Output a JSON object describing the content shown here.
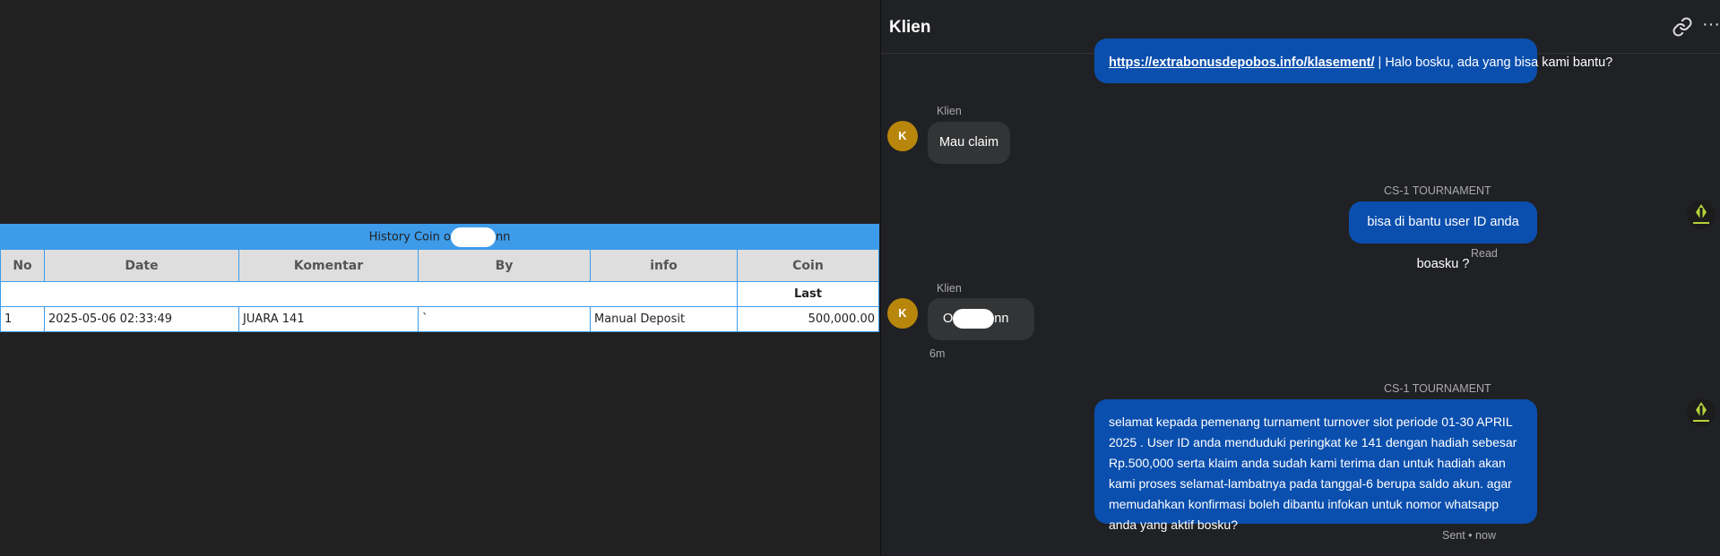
{
  "history": {
    "title_prefix": "History Coin o",
    "title_suffix": "nn",
    "columns": [
      "No",
      "Date",
      "Komentar",
      "By",
      "info",
      "Coin"
    ],
    "last_label": "Last",
    "rows": [
      {
        "no": "1",
        "date": "2025-05-06 02:33:49",
        "komentar": "JUARA 141",
        "by": "`",
        "info": "Manual Deposit",
        "coin": "500,000.00"
      }
    ]
  },
  "chat": {
    "title": "Klien",
    "more_label": "···",
    "msg1": {
      "link": "https://extrabonusdepobos.info/klasement/",
      "sep": "|",
      "text": "Halo bosku, ada yang bisa kami bantu?"
    },
    "msg2": {
      "sender": "Klien",
      "avatar": "K",
      "text": "Mau claim"
    },
    "msg3": {
      "sender": "CS-1 TOURNAMENT",
      "text": "bisa di bantu user ID anda boasku ?",
      "status": "Read"
    },
    "msg4": {
      "sender": "Klien",
      "avatar": "K",
      "text_prefix": "O",
      "text_suffix": "nn",
      "time": "6m"
    },
    "msg5": {
      "sender": "CS-1 TOURNAMENT",
      "text": "selamat kepada pemenang turnament turnover slot periode 01-30 APRIL 2025 . User ID anda menduduki peringkat ke 141 dengan hadiah sebesar Rp.500,000 serta klaim anda sudah kami terima dan untuk hadiah akan kami proses selamat-lambatnya pada tanggal-6 berupa saldo akun. agar memudahkan konfirmasi boleh dibantu infokan untuk nomor whatsapp anda yang aktif bosku?",
      "status": "Sent • now"
    }
  },
  "colors": {
    "accent": "#3d9be9",
    "bubble_out": "#0b4fae",
    "avatar": "#b8860b",
    "coin": "#2a8a1a"
  }
}
